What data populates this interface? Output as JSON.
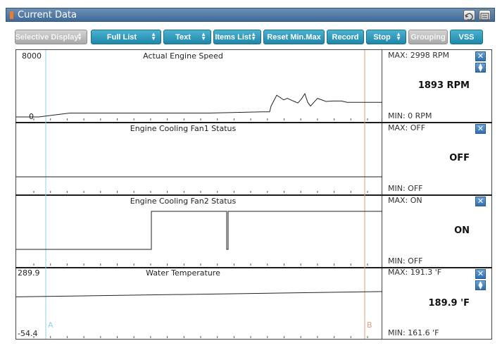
{
  "window": {
    "title": "Current Data"
  },
  "toolbar": {
    "buttons": [
      {
        "label": "Selective Display",
        "dropdown": true,
        "enabled": false
      },
      {
        "label": "Full List",
        "dropdown": true,
        "enabled": true
      },
      {
        "label": "Text",
        "dropdown": true,
        "enabled": true
      },
      {
        "label": "Items List",
        "dropdown": true,
        "enabled": true
      },
      {
        "label": "Reset Min.Max",
        "dropdown": false,
        "enabled": true
      },
      {
        "label": "Record",
        "dropdown": false,
        "enabled": true
      },
      {
        "label": "Stop",
        "dropdown": true,
        "enabled": true
      },
      {
        "label": "Grouping",
        "dropdown": false,
        "enabled": false
      },
      {
        "label": "VSS",
        "dropdown": false,
        "enabled": true
      }
    ]
  },
  "cursors": {
    "a_label": "A",
    "b_label": "B",
    "a_color": "#8fd3ea",
    "b_color": "#d9a27a"
  },
  "colors": {
    "accent": "#1e86a8",
    "titlebar": "#4f7aa8",
    "close_button": "#2f6fae"
  },
  "icons": [
    "window-icon",
    "retry-icon",
    "menu-icon",
    "close-icon",
    "scroll-icon"
  ],
  "panels": [
    {
      "title": "Actual Engine Speed",
      "y_max_label": "8000",
      "y_min_label": "0",
      "max_text": "MAX:  2998 RPM",
      "current_text": "1893 RPM",
      "min_text": "MIN:    0 RPM",
      "has_scroll": true
    },
    {
      "title": "Engine Cooling Fan1 Status",
      "y_max_label": "",
      "y_min_label": "",
      "max_text": "MAX: OFF",
      "current_text": "OFF",
      "min_text": "MIN: OFF",
      "has_scroll": false
    },
    {
      "title": "Engine Cooling Fan2 Status",
      "y_max_label": "",
      "y_min_label": "",
      "max_text": "MAX: ON",
      "current_text": "ON",
      "min_text": "MIN: OFF",
      "has_scroll": false
    },
    {
      "title": "Water Temperature",
      "y_max_label": "289.9",
      "y_min_label": "-54.4",
      "max_text": "MAX: 191.3 'F",
      "current_text": "189.9 'F",
      "min_text": "MIN: 161.6 'F",
      "has_scroll": true
    }
  ],
  "chart_data": {
    "type": "line",
    "x": [
      0,
      32,
      76,
      274,
      350,
      360,
      362,
      370,
      375,
      380,
      385,
      390,
      395,
      400,
      405,
      410,
      414,
      418,
      428,
      440,
      450,
      462,
      470,
      510,
      518,
      520
    ],
    "series": [
      {
        "name": "Actual Engine Speed",
        "ylim": [
          0,
          8000
        ],
        "values": [
          0,
          0,
          500,
          500,
          650,
          650,
          1400,
          2800,
          2500,
          2200,
          2400,
          2200,
          2000,
          1800,
          2300,
          2998,
          1900,
          1400,
          2400,
          2000,
          2050,
          2050,
          1893,
          1893,
          1893,
          1893
        ]
      },
      {
        "name": "Engine Cooling Fan1 Status",
        "states": [
          "OFF",
          "ON"
        ],
        "values": [
          0,
          0,
          0,
          0,
          0,
          0,
          0,
          0,
          0,
          0,
          0,
          0,
          0,
          0,
          0,
          0,
          0,
          0,
          0,
          0,
          0,
          0,
          0,
          0,
          0,
          0
        ]
      },
      {
        "name": "Engine Cooling Fan2 Status",
        "states": [
          "OFF",
          "ON"
        ],
        "segments": [
          {
            "x": 0,
            "value": 0
          },
          {
            "x": 192,
            "value": 1
          },
          {
            "x": 297,
            "value": 1
          },
          {
            "x": 299,
            "value": 0
          },
          {
            "x": 301,
            "value": 1
          },
          {
            "x": 520,
            "value": 1
          }
        ]
      },
      {
        "name": "Water Temperature",
        "ylim": [
          -54.4,
          289.9
        ],
        "x": [
          0,
          520
        ],
        "values": [
          161.6,
          191.3
        ]
      }
    ]
  }
}
